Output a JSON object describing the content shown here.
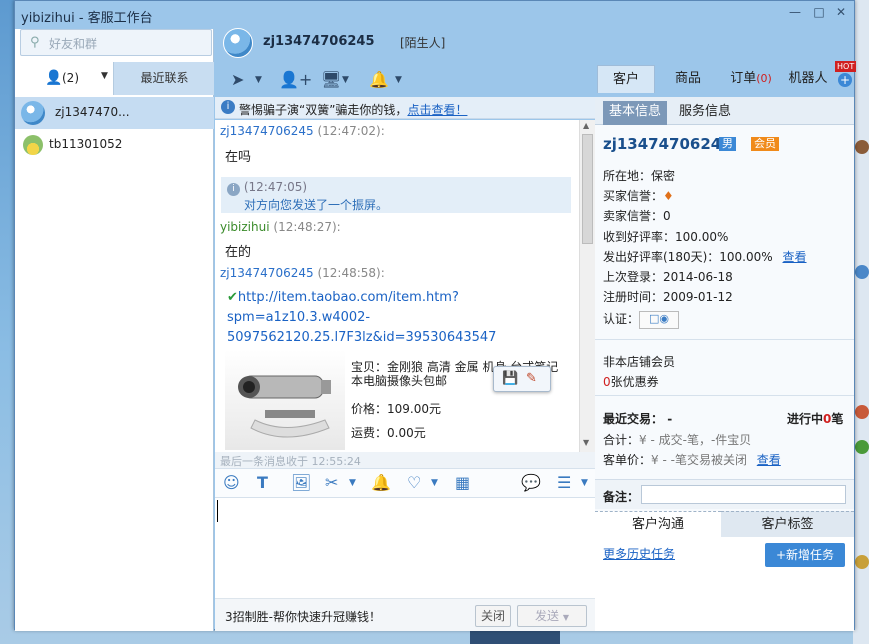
{
  "window": {
    "title": "yibizihui - 客服工作台",
    "controls": [
      "minimize",
      "maximize",
      "close"
    ]
  },
  "left": {
    "search_placeholder": "好友和群",
    "tabs": {
      "contacts_count": "(2)",
      "recent": "最近联系"
    },
    "conversations": [
      {
        "name": "zj1347470...",
        "selected": true
      },
      {
        "name": "tb11301052",
        "selected": false
      }
    ]
  },
  "chat_header": {
    "name": "zj13474706245",
    "tag": "[陌生人]"
  },
  "right_tabs": {
    "customer": "客户",
    "goods": "商品",
    "orders": "订单",
    "orders_count": "(0)",
    "robot": "机器人",
    "hot": "HOT"
  },
  "notice": {
    "text": "警惕骗子演“双簧”骗走你的钱，",
    "link": "点击查看！"
  },
  "messages": [
    {
      "who": "zj13474706245",
      "time": "(12:47:02):",
      "text": "在吗"
    },
    {
      "sys_time": "(12:47:05)",
      "sys_text": "对方向您发送了一个振屏。"
    },
    {
      "who": "yibizihui",
      "time": "(12:48:27):",
      "text": "在的"
    },
    {
      "who": "zj13474706245",
      "time": "(12:48:58):"
    }
  ],
  "link": {
    "line1": "http://item.taobao.com/item.htm?",
    "line2": "spm=a1z10.3.w4002-",
    "line3": "5097562120.25.l7F3lz&id=39530643547"
  },
  "product": {
    "desc_label": "宝贝：",
    "desc": "金刚狼 高清 金属 机身 台式笔记本电脑摄像头包邮",
    "price_label": "价格：",
    "price": "109.00元",
    "ship_label": "运费：",
    "ship": "0.00元"
  },
  "last_msg": "最后一条消息收于 12:55:24",
  "bottom": {
    "ad": "3招制胜-帮你快速升冠赚钱！",
    "close": "关闭",
    "send": "发送"
  },
  "right_panel": {
    "tabs": {
      "basic": "基本信息",
      "service": "服务信息"
    },
    "name": "zj13474706245",
    "gender": "男",
    "member": "会员",
    "location_label": "所在地：",
    "location": "保密",
    "buyer_credit_label": "买家信誉：",
    "seller_credit_label": "卖家信誉：",
    "seller_credit": "0",
    "good_rate_label": "收到好评率：",
    "good_rate": "100.00%",
    "give_rate_label": "发出好评率(180天)：",
    "give_rate": "100.00%",
    "view": "查看",
    "last_login_label": "上次登录：",
    "last_login": "2014-06-18",
    "register_label": "注册时间：",
    "register": "2009-01-12",
    "auth_label": "认证：",
    "non_member": "非本店铺会员",
    "coupon_count": "0",
    "coupon_label": "张优惠券",
    "recent_trade_label": "最近交易：",
    "recent_trade": "-",
    "in_progress": "进行中",
    "in_progress_count": "0",
    "in_progress_unit": "笔",
    "total_label": "合计：",
    "total": "¥ -    成交-笔，-件宝贝",
    "avg_label": "客单价：",
    "avg": "¥ -    -笔交易被关闭",
    "view2": "查看",
    "remark_label": "备注：",
    "tab_comm": "客户沟通",
    "tab_tags": "客户标签",
    "history": "更多历史任务",
    "new_task": "+新增任务"
  },
  "colors": {
    "accent": "#3b88d6",
    "link": "#1a62c4",
    "title_bar": "#9cc6ea"
  }
}
